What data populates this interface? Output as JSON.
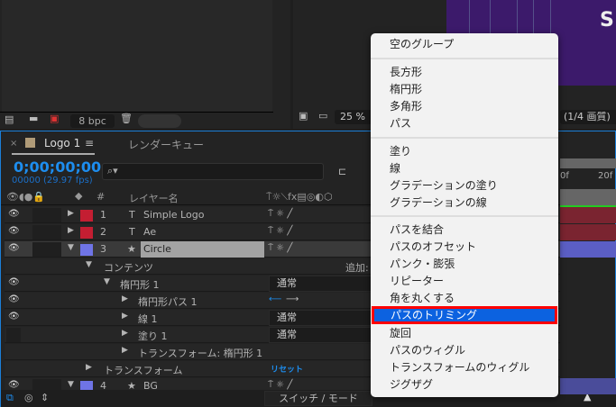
{
  "project_panel": {
    "bpc": "8 bpc"
  },
  "viewer": {
    "zoom": "25 %",
    "quality": "(1/4 画質)",
    "comp_letter": "S"
  },
  "timeline": {
    "tabs": [
      {
        "label": "Logo 1",
        "active": true
      },
      {
        "label": "レンダーキュー",
        "active": false
      }
    ],
    "timecode": "0;00;00;00",
    "fps": "00000 (29.97 fps)",
    "columns": {
      "number": "#",
      "layer_name": "レイヤー名",
      "add": "追加:"
    },
    "layers": [
      {
        "num": "1",
        "type": "T",
        "name": "Simple Logo",
        "color": "#c41e32"
      },
      {
        "num": "2",
        "type": "T",
        "name": "Ae",
        "color": "#c41e32"
      },
      {
        "num": "3",
        "type": "★",
        "name": "Circle",
        "color": "#6f74e6"
      },
      {
        "num": "4",
        "type": "★",
        "name": "BG",
        "color": "#6f74e6"
      }
    ],
    "contents": "コンテンツ",
    "ellipse_group": "楕円形 1",
    "ellipse_path": "楕円形パス 1",
    "stroke": "線 1",
    "fill": "塗り 1",
    "group_transform": "トランスフォーム: 楕円形 1",
    "transform": "トランスフォーム",
    "reset": "リセット",
    "blend_mode": "通常",
    "ruler": [
      "0f",
      "20f"
    ],
    "switch_mode": "スイッチ / モード"
  },
  "menu": {
    "groups": [
      [
        "空のグループ"
      ],
      [
        "長方形",
        "楕円形",
        "多角形",
        "パス"
      ],
      [
        "塗り",
        "線",
        "グラデーションの塗り",
        "グラデーションの線"
      ],
      [
        "パスを結合",
        "パスのオフセット",
        "パンク・膨張",
        "リピーター",
        "角を丸くする",
        "パスのトリミング",
        "旋回",
        "パスのウィグル",
        "トランスフォームのウィグル",
        "ジグザグ"
      ]
    ],
    "highlighted": "パスのトリミング",
    "accent": "#0c62e0"
  }
}
